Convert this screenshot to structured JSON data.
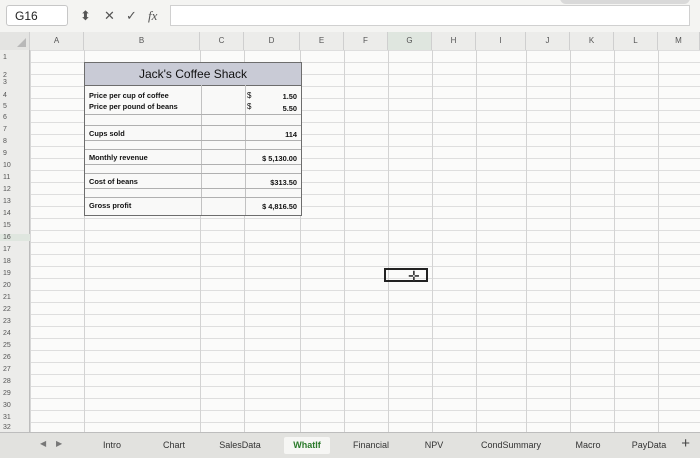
{
  "formula_bar": {
    "name_box": "G16",
    "cancel_symbol": "✕",
    "accept_symbol": "✓",
    "function_symbol": "fx",
    "formula_value": ""
  },
  "columns": [
    "A",
    "B",
    "C",
    "D",
    "E",
    "F",
    "G",
    "H",
    "I",
    "J",
    "K",
    "L",
    "M"
  ],
  "rows": [
    "1",
    "2",
    "3",
    "4",
    "5",
    "6",
    "7",
    "8",
    "9",
    "10",
    "11",
    "12",
    "13",
    "14",
    "15",
    "16",
    "17",
    "18",
    "19",
    "20",
    "21",
    "22",
    "23",
    "24",
    "25",
    "26",
    "27",
    "28",
    "29",
    "30",
    "31",
    "32"
  ],
  "table": {
    "title": "Jack's Coffee Shack",
    "price_cup_label": "Price per cup of coffee",
    "price_cup_dollar": "$",
    "price_cup_value": "1.50",
    "price_beans_label": "Price per pound of beans",
    "price_beans_dollar": "$",
    "price_beans_value": "5.50",
    "cups_sold_label": "Cups sold",
    "cups_sold_value": "114",
    "monthly_revenue_label": "Monthly revenue",
    "monthly_revenue_value": "$ 5,130.00",
    "cost_beans_label": "Cost of beans",
    "cost_beans_value": "$313.50",
    "gross_profit_label": "Gross profit",
    "gross_profit_value": "$ 4,816.50"
  },
  "selected_cell": "G16",
  "sheet_tabs": [
    "Intro",
    "Chart",
    "SalesData",
    "WhatIf",
    "Financial",
    "NPV",
    "CondSummary",
    "Macro",
    "PayData"
  ],
  "active_tab": "WhatIf",
  "add_sheet_symbol": "+",
  "colors": {
    "active_tab_text": "#2a7a2a",
    "title_fill": "#c9cbd6"
  }
}
